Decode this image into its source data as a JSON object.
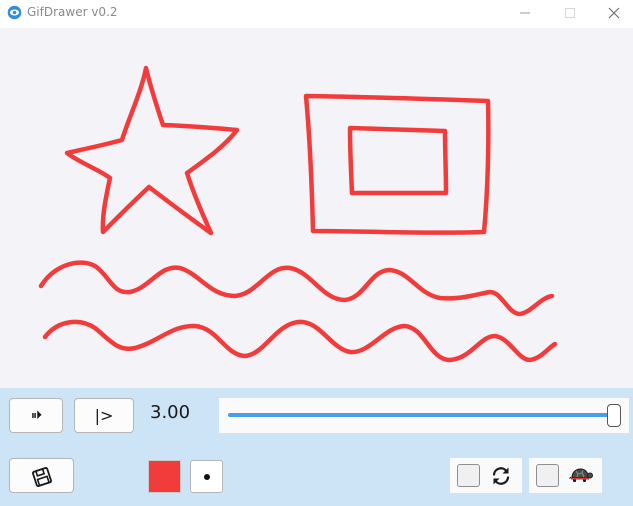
{
  "window": {
    "title": "GifDrawer v0.2",
    "icons": {
      "app": "eye-icon",
      "minimize": "minimize-icon",
      "maximize": "maximize-icon",
      "close": "close-icon"
    }
  },
  "canvas": {
    "background": "#f3f3f8",
    "stroke_color": "#f23c3c",
    "drawn_shapes": [
      "star",
      "nested-rectangles",
      "wavy-line",
      "wavy-line"
    ]
  },
  "controls": {
    "play_pause_label": "⏸⏵",
    "step_label": "|>",
    "speed_value": "3.00",
    "speed_slider_fraction": 1.0,
    "save_icon": "floppy-disk-icon",
    "color_swatch": "#f23c3c",
    "brush_icon": "dot-icon",
    "loop_checked": false,
    "loop_icon": "refresh-icon",
    "slow_checked": false,
    "slow_icon": "turtle-icon"
  },
  "colors": {
    "panel": "#cce4f6",
    "accent": "#4a9ee8"
  }
}
